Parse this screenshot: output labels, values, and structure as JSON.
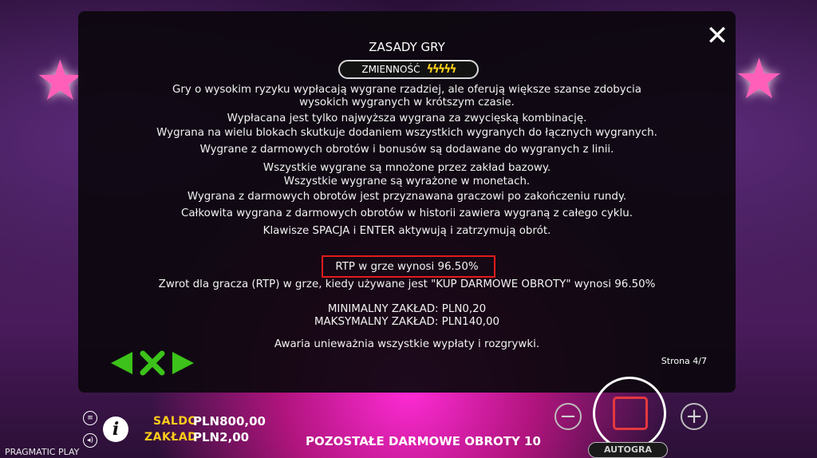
{
  "rules": {
    "title": "ZASADY GRY",
    "volatility_label": "ZMIENNOŚĆ",
    "volatility_bolts": "ϟϟϟϟϟ",
    "para1": [
      "Gry o wysokim ryzyku wypłacają wygrane rzadziej, ale oferują większe szanse zdobycia",
      "wysokich wygranych w krótszym czasie."
    ],
    "lines": [
      "Wypłacana jest tylko najwyższa wygrana za zwycięską kombinację.",
      "Wygrana na wielu blokach skutkuje dodaniem wszystkich wygranych do łącznych wygranych.",
      "Wygrane z darmowych obrotów i bonusów są dodawane do wygranych z linii.",
      "Wszystkie wygrane są mnożone przez zakład bazowy.",
      "Wszystkie wygrane są wyrażone w monetach.",
      "Wygrana z darmowych obrotów jest przyznawana graczowi po zakończeniu rundy.",
      "Całkowita wygrana z darmowych obrotów w historii zawiera wygraną z całego cyklu.",
      "Klawisze SPACJA i ENTER aktywują i zatrzymują obrót."
    ],
    "rtp": "RTP w grze wynosi 96.50%",
    "rtp_buy": "Zwrot dla gracza (RTP) w grze, kiedy używane jest \"KUP DARMOWE OBROTY\" wynosi 96.50%",
    "min_bet": "MINIMALNY ZAKŁAD: PLN0,20",
    "max_bet": "MAKSYMALNY ZAKŁAD: PLN140,00",
    "malfunction": "Awaria unieważnia wszystkie wypłaty i rozgrywki.",
    "page": "Strona 4/7",
    "close_icon": "✕"
  },
  "hud": {
    "balance_label": "SALDO",
    "balance_value": "PLN800,00",
    "bet_label": "ZAKŁAD",
    "bet_value": "PLN2,00",
    "free_spins": "POZOSTAŁE DARMOWE OBROTY 10",
    "brand": "PRAGMATIC PLAY",
    "autoplay": "AUTOGRA",
    "minus": "−",
    "plus": "+",
    "info": "i"
  },
  "colors": {
    "accent_green": "#3cc21a",
    "highlight_red": "#e31b1b",
    "label_yellow": "#ffcc1a"
  }
}
